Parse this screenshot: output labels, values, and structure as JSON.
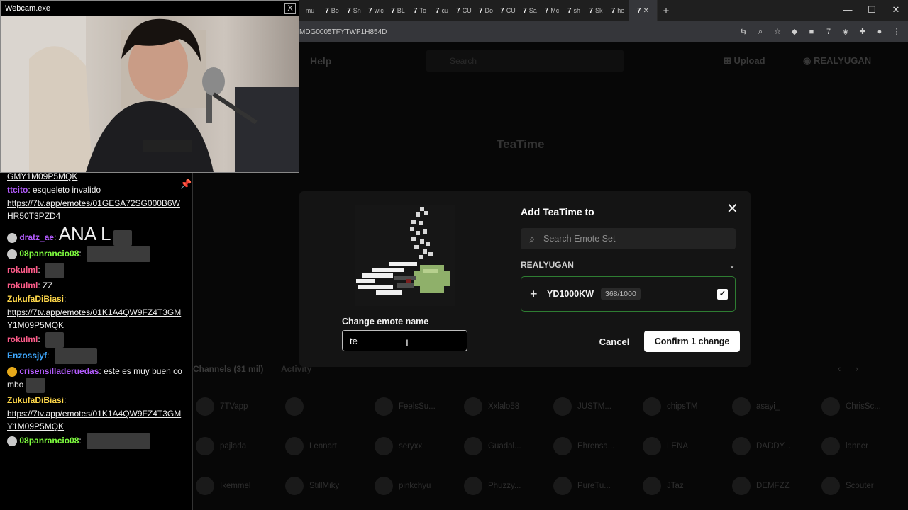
{
  "webcam": {
    "title": "Webcam.exe",
    "close": "X"
  },
  "browser": {
    "tabs": [
      {
        "label": "mu",
        "fav": ""
      },
      {
        "label": "Bo",
        "fav": "7"
      },
      {
        "label": "Sn",
        "fav": "7"
      },
      {
        "label": "wic",
        "fav": "7"
      },
      {
        "label": "BL",
        "fav": "7"
      },
      {
        "label": "To",
        "fav": "7"
      },
      {
        "label": "cu",
        "fav": "7"
      },
      {
        "label": "CU",
        "fav": "7"
      },
      {
        "label": "Do",
        "fav": "7"
      },
      {
        "label": "CU",
        "fav": "7"
      },
      {
        "label": "Sa",
        "fav": "7"
      },
      {
        "label": "Mc",
        "fav": "7"
      },
      {
        "label": "sh",
        "fav": "7"
      },
      {
        "label": "Sk",
        "fav": "7"
      },
      {
        "label": "he",
        "fav": "7"
      }
    ],
    "active_tab": {
      "fav": "7",
      "close": "✕"
    },
    "new_tab": "+",
    "window_controls": {
      "minimize": "—",
      "maximize": "☐",
      "close": "✕"
    },
    "url": "MDG0005TFYTWP1H854D",
    "colors": {
      "tabbar": "#1f1f1f",
      "addrbar": "#35363a"
    }
  },
  "site": {
    "help": "Help",
    "search_placeholder": "Search",
    "upload": "Upload",
    "username": "REALYUGAN",
    "emote_title": "TeaTime",
    "channels_tab": "Channels (31 mil)",
    "activity_tab": "Activity",
    "pager_prev": "‹",
    "pager_next": "›",
    "channels": [
      "7TVapp",
      "",
      "FeelsSu...",
      "Xxlalo58",
      "JUSTM...",
      "chipsTM",
      "asayi_",
      "ChrisSc...",
      "pajlada",
      "Lennart",
      "seryxx",
      "Guadal...",
      "Ehrensa...",
      "LENA",
      "DADDY...",
      "lanner",
      "Ikemmel",
      "StillMiky",
      "pinkchyu",
      "Phuzzy...",
      "PureTu...",
      "JTaz",
      "DEMFZZ",
      "Scouter"
    ]
  },
  "modal": {
    "change_name_label": "Change emote name",
    "name_value": "te",
    "add_title": "Add TeaTime to",
    "close": "✕",
    "search_placeholder": "Search Emote Set",
    "owner": "REALYUGAN",
    "owner_chevron": "⌄",
    "set": {
      "name": "YD1000KW",
      "count": "368/1000",
      "checked": "✓"
    },
    "cancel": "Cancel",
    "confirm": "Confirm 1 change",
    "accent": "#2e7d32"
  },
  "chat": {
    "pin": "📌",
    "messages": [
      {
        "user": "",
        "color": "",
        "text": "",
        "link": "GMY1M09P5MQK"
      },
      {
        "user": "ttcito",
        "color": "#b45cff",
        "text": "esqueleto invalido",
        "link": ""
      },
      {
        "user": "",
        "color": "",
        "text": "",
        "link": "https://7tv.app/emotes/01GESA72SG000B6WHR50T3PZD4"
      },
      {
        "user": "dratz_ae",
        "color": "#b45cff",
        "text": "ANA L",
        "link": ""
      },
      {
        "user": "08panrancio08",
        "color": "#7fff3f",
        "text": "",
        "link": ""
      },
      {
        "user": "rokulml",
        "color": "#ff5c8a",
        "text": "",
        "link": ""
      },
      {
        "user": "rokulml",
        "color": "#ff5c8a",
        "text": "ZZ",
        "link": ""
      },
      {
        "user": "ZukufaDiBiasi",
        "color": "#ffd84a",
        "text": "",
        "link": ""
      },
      {
        "user": "",
        "color": "",
        "text": "",
        "link": "https://7tv.app/emotes/01K1A4QW9FZ4T3GMY1M09P5MQK"
      },
      {
        "user": "rokulml",
        "color": "#ff5c8a",
        "text": "",
        "link": ""
      },
      {
        "user": "Enzossjyf",
        "color": "#3fa9ff",
        "text": "",
        "link": ""
      },
      {
        "user": "crisensilladeruedas",
        "color": "#b45cff",
        "text": "este es muy buen combo",
        "link": ""
      },
      {
        "user": "ZukufaDiBiasi",
        "color": "#ffd84a",
        "text": "",
        "link": ""
      },
      {
        "user": "",
        "color": "",
        "text": "",
        "link": "https://7tv.app/emotes/01K1A4QW9FZ4T3GMY1M09P5MQK"
      },
      {
        "user": "08panrancio08",
        "color": "#7fff3f",
        "text": "",
        "link": ""
      }
    ]
  }
}
